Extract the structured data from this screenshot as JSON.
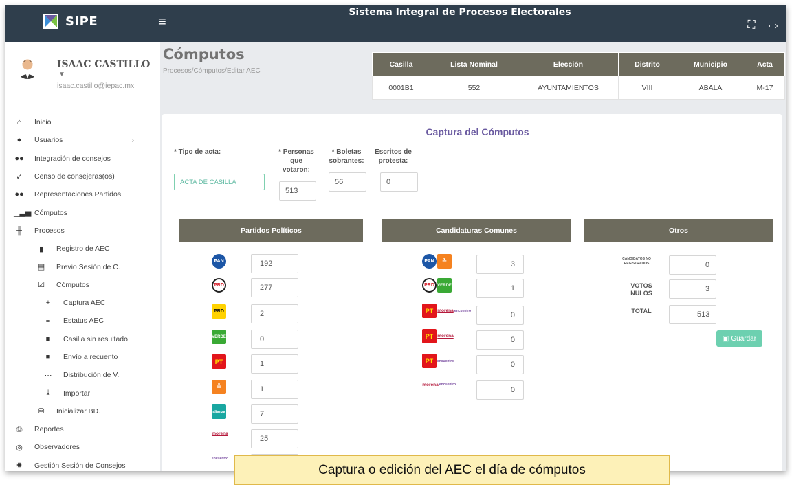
{
  "app": {
    "brand": "SIPE",
    "system_title": "Sistema Integral de Procesos Electorales",
    "menu_icon": "hamburger-icon",
    "actions": [
      "expand-icon",
      "logout-icon"
    ]
  },
  "user": {
    "name": "ISAAC CASTILLO",
    "email": "isaac.castillo@iepac.mx"
  },
  "nav": [
    {
      "label": "Inicio",
      "icon": "home-icon",
      "level": 0
    },
    {
      "label": "Usuarios",
      "icon": "users-icon",
      "level": 0,
      "has_children": true
    },
    {
      "label": "Integración de consejos",
      "icon": "group-icon",
      "level": 0
    },
    {
      "label": "Censo de consejeras(os)",
      "icon": "check-icon",
      "level": 0
    },
    {
      "label": "Representaciones Partidos",
      "icon": "team-icon",
      "level": 0
    },
    {
      "label": "Cómputos",
      "icon": "bar-chart-icon",
      "level": 0
    },
    {
      "label": "Procesos",
      "icon": "sliders-icon",
      "level": 0
    },
    {
      "label": "Registro de AEC",
      "icon": "file-plus-icon",
      "level": 1
    },
    {
      "label": "Previo Sesión de C.",
      "icon": "list-box-icon",
      "level": 1
    },
    {
      "label": "Cómputos",
      "icon": "clipboard-check-icon",
      "level": 1
    },
    {
      "label": "Captura AEC",
      "icon": "plus-icon",
      "level": 2
    },
    {
      "label": "Estatus AEC",
      "icon": "lines-icon",
      "level": 2
    },
    {
      "label": "Casilla sin resultado",
      "icon": "alert-box-icon",
      "level": 2
    },
    {
      "label": "Envío a recuento",
      "icon": "message-icon",
      "level": 2
    },
    {
      "label": "Distribución de V.",
      "icon": "dots-icon",
      "level": 2
    },
    {
      "label": "Importar",
      "icon": "import-icon",
      "level": 2
    },
    {
      "label": "Inicializar BD.",
      "icon": "database-icon",
      "level": 1
    },
    {
      "label": "Reportes",
      "icon": "printer-icon",
      "level": 0
    },
    {
      "label": "Observadores",
      "icon": "eye-icon",
      "level": 0
    },
    {
      "label": "Gestión Sesión de Consejos",
      "icon": "gear-dot-icon",
      "level": 0
    }
  ],
  "page": {
    "title": "Cómputos",
    "breadcrumb": "Procesos/Cómputos/Editar AEC"
  },
  "info_table": {
    "headers": [
      "Casilla",
      "Lista Nominal",
      "Elección",
      "Distrito",
      "Municipio",
      "Acta"
    ],
    "values": [
      "0001B1",
      "552",
      "AYUNTAMIENTOS",
      "VIII",
      "ABALA",
      "M-17"
    ]
  },
  "form": {
    "title": "Captura del Cómputos",
    "tipo_label": "* Tipo de acta:",
    "tipo_value": "ACTA DE CASILLA",
    "personas_label": "* Personas que votaron:",
    "personas_value": "513",
    "boletas_label": "* Boletas sobrantes:",
    "boletas_value": "56",
    "escritos_label": "Escritos de protesta:",
    "escritos_value": "0"
  },
  "sections": {
    "partidos": "Partidos Políticos",
    "comunes": "Candidaturas Comunes",
    "otros": "Otros"
  },
  "partidos": [
    {
      "logo": "PAN",
      "value": "192"
    },
    {
      "logo": "PRD",
      "value": "277"
    },
    {
      "logo": "PRD-sun",
      "value": "2"
    },
    {
      "logo": "VERDE",
      "value": "0"
    },
    {
      "logo": "PT",
      "value": "1"
    },
    {
      "logo": "MC",
      "value": "1"
    },
    {
      "logo": "alianza",
      "value": "7"
    },
    {
      "logo": "morena",
      "value": "25"
    },
    {
      "logo": "encuentro",
      "value": ""
    }
  ],
  "comunes": [
    {
      "logos": [
        "PAN",
        "MC"
      ],
      "value": "3"
    },
    {
      "logos": [
        "PRD",
        "VERDE"
      ],
      "value": "1"
    },
    {
      "logos": [
        "PT",
        "morena",
        "encuentro"
      ],
      "value": "0"
    },
    {
      "logos": [
        "PT",
        "morena"
      ],
      "value": "0"
    },
    {
      "logos": [
        "PT",
        "encuentro"
      ],
      "value": "0"
    },
    {
      "logos": [
        "morena",
        "encuentro"
      ],
      "value": "0"
    }
  ],
  "otros": {
    "no_registrados_label": "CANDIDATOS NO REGISTRADOS",
    "no_registrados_value": "0",
    "nulos_label": "VOTOS NULOS",
    "nulos_value": "3",
    "total_label": "TOTAL",
    "total_value": "513",
    "save_label": "Guardar"
  },
  "caption": "Captura o edición del AEC el día de cómputos",
  "colors": {
    "topbar": "#2f3e4c",
    "header_gray": "#6d6b5d",
    "accent_purple": "#6a5aa0",
    "save_green": "#6dd0b0"
  }
}
